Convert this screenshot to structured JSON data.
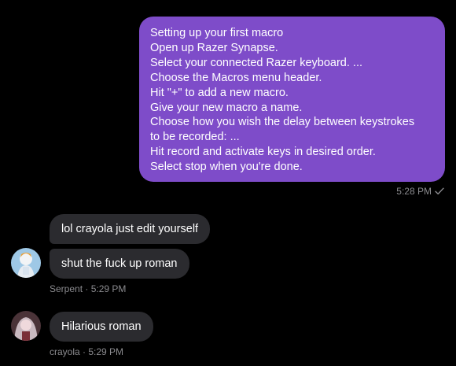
{
  "colors": {
    "outgoing_bubble": "#7e4cc9",
    "incoming_bubble": "#2b2b2f",
    "background": "#000000",
    "meta_text": "#8b8b8f"
  },
  "outgoing_message": {
    "lines": [
      "Setting up your first macro",
      "Open up Razer Synapse.",
      "Select your connected Razer keyboard. ...",
      "Choose the Macros menu header.",
      "Hit \"+\" to add a new macro.",
      "Give your new macro a name.",
      "Choose how you wish the delay between keystrokes",
      "to be recorded: ...",
      "Hit record and activate keys in desired order.",
      "Select stop when you're done."
    ],
    "time": "5:28 PM",
    "status_icon": "check-icon"
  },
  "incoming_groups": [
    {
      "messages": [
        "lol crayola just edit yourself",
        "shut the fuck up roman"
      ],
      "meta": "Serpent · 5:29 PM",
      "avatar_icon": "avatar-serpent"
    },
    {
      "messages": [
        "Hilarious roman"
      ],
      "meta": "crayola · 5:29 PM",
      "avatar_icon": "avatar-crayola"
    }
  ]
}
